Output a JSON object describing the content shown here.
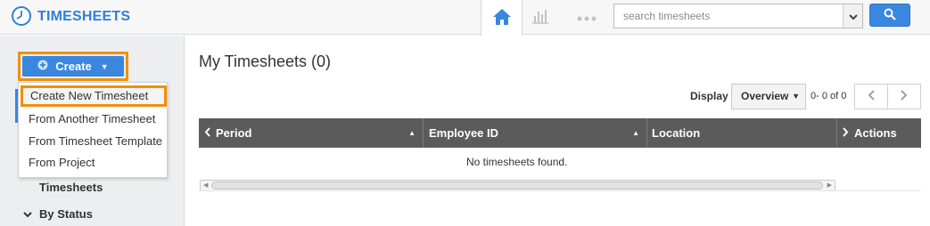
{
  "app": {
    "title": "TIMESHEETS",
    "brand_color": "#2e7fd8",
    "logo_icon": "clock-icon"
  },
  "nav": {
    "home_icon": "home-icon",
    "reports_icon": "bar-chart-icon",
    "more_icon": "more-dots-icon",
    "active_color": "#3a87e0"
  },
  "search": {
    "placeholder": "search timesheets",
    "value": "",
    "button_icon": "search-icon"
  },
  "sidebar": {
    "create_label": "Create",
    "menu": [
      {
        "label": "Create New Timesheet",
        "highlighted": true
      },
      {
        "label": "From Another Timesheet"
      },
      {
        "label": "From Timesheet Template"
      },
      {
        "label": "From Project"
      }
    ],
    "section_item": "Timesheets",
    "group_label": "By Status"
  },
  "main": {
    "title": "My Timesheets (0)",
    "display_label": "Display",
    "display_value": "Overview",
    "range": "0- 0 of 0",
    "columns": [
      "Period",
      "Employee ID",
      "Location",
      "Actions"
    ],
    "empty_message": "No timesheets found."
  },
  "colors": {
    "highlight_border": "#f0900c",
    "header_bg": "#5b5b5b",
    "primary": "#3a87e0"
  }
}
